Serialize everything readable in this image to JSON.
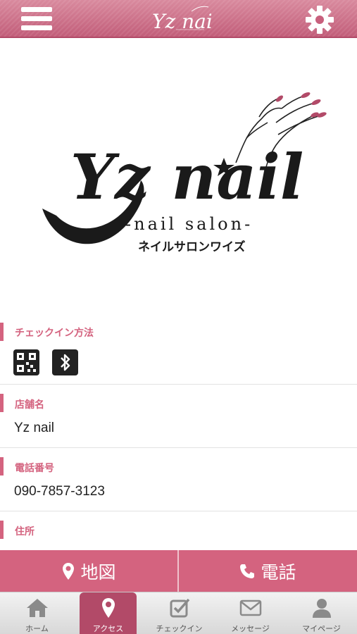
{
  "header": {
    "menu_icon": "hamburger-menu-icon",
    "settings_icon": "gear-icon",
    "logo_text": "Yz nail",
    "colors": {
      "header": "#c8607d",
      "accent": "#d4637f",
      "active_tab": "#b24a68"
    }
  },
  "logo": {
    "brand": "Yz nail",
    "tagline": "-nail salon-",
    "katakana": "ネイルサロンワイズ"
  },
  "sections": {
    "checkin": {
      "label": "チェックイン方法",
      "icons": [
        "qr-code-icon",
        "bluetooth-icon"
      ]
    },
    "shop_name": {
      "label": "店舗名",
      "value": "Yz nail"
    },
    "phone": {
      "label": "電話番号",
      "value": "090-7857-3123"
    },
    "address": {
      "label": "住所"
    }
  },
  "actions": {
    "map_label": "地図",
    "tel_label": "電話"
  },
  "tabs": [
    {
      "label": "ホーム",
      "icon": "home-icon",
      "active": false
    },
    {
      "label": "アクセス",
      "icon": "map-pin-icon",
      "active": true
    },
    {
      "label": "チェックイン",
      "icon": "checkbox-icon",
      "active": false
    },
    {
      "label": "メッセージ",
      "icon": "envelope-icon",
      "active": false
    },
    {
      "label": "マイページ",
      "icon": "person-icon",
      "active": false
    }
  ]
}
